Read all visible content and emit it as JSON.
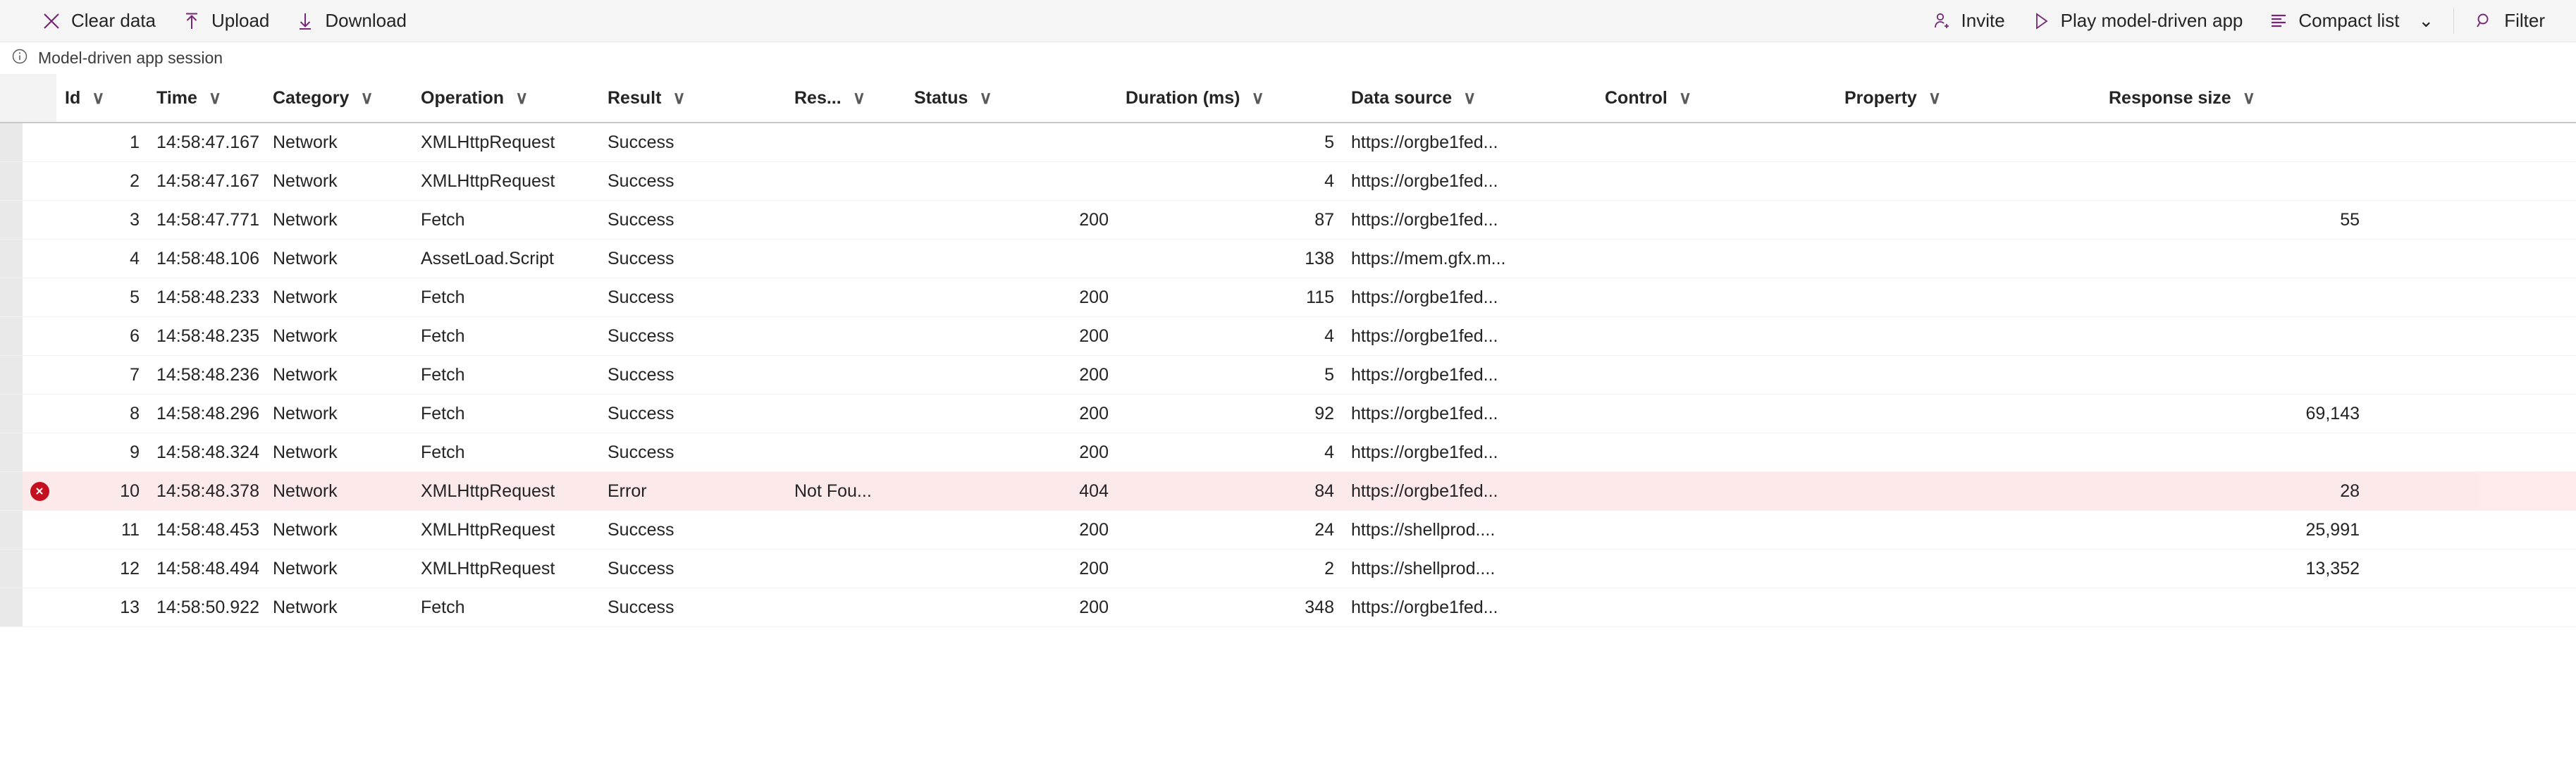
{
  "toolbar": {
    "left": [
      {
        "label": "Clear data",
        "icon": "close-x-icon"
      },
      {
        "label": "Upload",
        "icon": "upload-arrow-icon"
      },
      {
        "label": "Download",
        "icon": "download-arrow-icon"
      }
    ],
    "right": [
      {
        "label": "Invite",
        "icon": "person-add-icon"
      },
      {
        "label": "Play model-driven app",
        "icon": "play-triangle-icon"
      },
      {
        "label": "Compact list",
        "icon": "list-lines-icon",
        "chevron": "⌄"
      },
      {
        "label": "Filter",
        "icon": "search-magnifier-icon"
      }
    ],
    "accent_color": "#742774"
  },
  "infobar": {
    "icon": "info-circle-icon",
    "text": "Model-driven app session"
  },
  "table": {
    "sort_chevron": "∨",
    "columns": [
      {
        "key": "id",
        "label": "Id",
        "align": "right"
      },
      {
        "key": "time",
        "label": "Time",
        "align": "left"
      },
      {
        "key": "category",
        "label": "Category",
        "align": "left"
      },
      {
        "key": "operation",
        "label": "Operation",
        "align": "left"
      },
      {
        "key": "result",
        "label": "Result",
        "align": "left"
      },
      {
        "key": "reason",
        "label": "Res...",
        "align": "left"
      },
      {
        "key": "status",
        "label": "Status",
        "align": "right"
      },
      {
        "key": "duration",
        "label": "Duration (ms)",
        "align": "right"
      },
      {
        "key": "source",
        "label": "Data source",
        "align": "left"
      },
      {
        "key": "control",
        "label": "Control",
        "align": "left"
      },
      {
        "key": "property",
        "label": "Property",
        "align": "left"
      },
      {
        "key": "size",
        "label": "Response size",
        "align": "right"
      }
    ],
    "rows": [
      {
        "id": "1",
        "time": "14:58:47.167",
        "category": "Network",
        "operation": "XMLHttpRequest",
        "result": "Success",
        "reason": "",
        "status": "",
        "duration": "5",
        "source": "https://orgbe1fed...",
        "control": "",
        "property": "",
        "size": "",
        "error": false
      },
      {
        "id": "2",
        "time": "14:58:47.167",
        "category": "Network",
        "operation": "XMLHttpRequest",
        "result": "Success",
        "reason": "",
        "status": "",
        "duration": "4",
        "source": "https://orgbe1fed...",
        "control": "",
        "property": "",
        "size": "",
        "error": false
      },
      {
        "id": "3",
        "time": "14:58:47.771",
        "category": "Network",
        "operation": "Fetch",
        "result": "Success",
        "reason": "",
        "status": "200",
        "duration": "87",
        "source": "https://orgbe1fed...",
        "control": "",
        "property": "",
        "size": "55",
        "error": false
      },
      {
        "id": "4",
        "time": "14:58:48.106",
        "category": "Network",
        "operation": "AssetLoad.Script",
        "result": "Success",
        "reason": "",
        "status": "",
        "duration": "138",
        "source": "https://mem.gfx.m...",
        "control": "",
        "property": "",
        "size": "",
        "error": false
      },
      {
        "id": "5",
        "time": "14:58:48.233",
        "category": "Network",
        "operation": "Fetch",
        "result": "Success",
        "reason": "",
        "status": "200",
        "duration": "115",
        "source": "https://orgbe1fed...",
        "control": "",
        "property": "",
        "size": "",
        "error": false
      },
      {
        "id": "6",
        "time": "14:58:48.235",
        "category": "Network",
        "operation": "Fetch",
        "result": "Success",
        "reason": "",
        "status": "200",
        "duration": "4",
        "source": "https://orgbe1fed...",
        "control": "",
        "property": "",
        "size": "",
        "error": false
      },
      {
        "id": "7",
        "time": "14:58:48.236",
        "category": "Network",
        "operation": "Fetch",
        "result": "Success",
        "reason": "",
        "status": "200",
        "duration": "5",
        "source": "https://orgbe1fed...",
        "control": "",
        "property": "",
        "size": "",
        "error": false
      },
      {
        "id": "8",
        "time": "14:58:48.296",
        "category": "Network",
        "operation": "Fetch",
        "result": "Success",
        "reason": "",
        "status": "200",
        "duration": "92",
        "source": "https://orgbe1fed...",
        "control": "",
        "property": "",
        "size": "69,143",
        "error": false
      },
      {
        "id": "9",
        "time": "14:58:48.324",
        "category": "Network",
        "operation": "Fetch",
        "result": "Success",
        "reason": "",
        "status": "200",
        "duration": "4",
        "source": "https://orgbe1fed...",
        "control": "",
        "property": "",
        "size": "",
        "error": false
      },
      {
        "id": "10",
        "time": "14:58:48.378",
        "category": "Network",
        "operation": "XMLHttpRequest",
        "result": "Error",
        "reason": "Not Fou...",
        "status": "404",
        "duration": "84",
        "source": "https://orgbe1fed...",
        "control": "",
        "property": "",
        "size": "28",
        "error": true
      },
      {
        "id": "11",
        "time": "14:58:48.453",
        "category": "Network",
        "operation": "XMLHttpRequest",
        "result": "Success",
        "reason": "",
        "status": "200",
        "duration": "24",
        "source": "https://shellprod....",
        "control": "",
        "property": "",
        "size": "25,991",
        "error": false
      },
      {
        "id": "12",
        "time": "14:58:48.494",
        "category": "Network",
        "operation": "XMLHttpRequest",
        "result": "Success",
        "reason": "",
        "status": "200",
        "duration": "2",
        "source": "https://shellprod....",
        "control": "",
        "property": "",
        "size": "13,352",
        "error": false
      },
      {
        "id": "13",
        "time": "14:58:50.922",
        "category": "Network",
        "operation": "Fetch",
        "result": "Success",
        "reason": "",
        "status": "200",
        "duration": "348",
        "source": "https://orgbe1fed...",
        "control": "",
        "property": "",
        "size": "",
        "error": false
      }
    ],
    "error_row_icon": "error-circle-icon",
    "error_row_color": "#fce9ea"
  }
}
